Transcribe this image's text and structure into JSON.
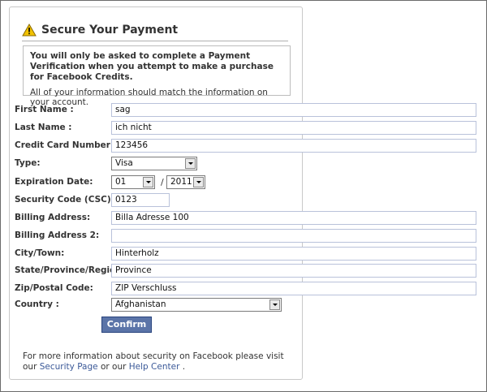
{
  "title": "Secure Your Payment",
  "notice": {
    "bold": "You will only be asked to complete a Payment Verification when you attempt to make a purchase for Facebook Credits.",
    "text": "All of your information should match the information on your account."
  },
  "form": {
    "first_name": {
      "label": "First Name :",
      "value": "sag"
    },
    "last_name": {
      "label": "Last Name :",
      "value": "ich nicht"
    },
    "card_number": {
      "label": "Credit Card Number:",
      "value": "123456"
    },
    "type": {
      "label": "Type:",
      "value": "Visa"
    },
    "expiration": {
      "label": "Expiration Date:",
      "month": "01",
      "separator": "/",
      "year": "2011"
    },
    "security_code": {
      "label": "Security Code (CSC):",
      "value": "0123"
    },
    "billing_address": {
      "label": "Billing Address:",
      "value": "Billa Adresse 100"
    },
    "billing_address_2": {
      "label": "Billing Address 2:",
      "value": ""
    },
    "city": {
      "label": "City/Town:",
      "value": "Hinterholz"
    },
    "state": {
      "label": "State/Province/Region:",
      "value": "Province"
    },
    "zip": {
      "label": "Zip/Postal Code:",
      "value": "ZIP Verschluss"
    },
    "country": {
      "label": "Country :",
      "value": "Afghanistan"
    }
  },
  "confirm_label": "Confirm",
  "footer": {
    "text_before": "For more information about security on Facebook please visit our ",
    "security_page_link": "Security Page",
    "text_middle": " or our ",
    "help_center_link": "Help Center",
    "text_after": " ."
  },
  "colors": {
    "link": "#3b5998",
    "button": "#5b74a8",
    "warning": "#f2c200"
  },
  "icons": {
    "title": "warning-icon",
    "dropdown": "chevron-down-icon"
  }
}
